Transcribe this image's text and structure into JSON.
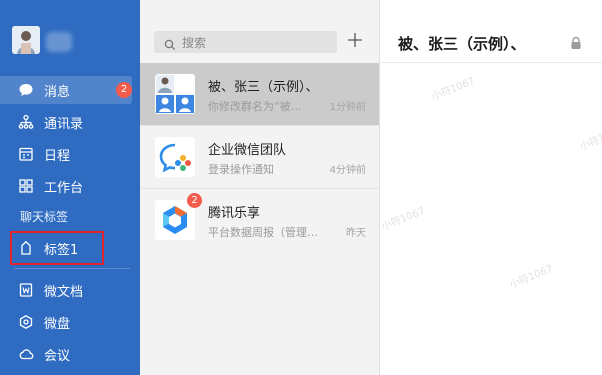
{
  "sidebar": {
    "badge_count": "2",
    "items": [
      {
        "label": "消息",
        "icon": "chat-bubble-icon"
      },
      {
        "label": "通讯录",
        "icon": "org-chart-icon"
      },
      {
        "label": "日程",
        "icon": "calendar-icon"
      },
      {
        "label": "工作台",
        "icon": "grid-icon"
      }
    ],
    "section_title": "聊天标签",
    "tag": {
      "label": "标签1",
      "icon": "tag-icon"
    },
    "apps": [
      {
        "label": "微文档",
        "icon": "document-w-icon"
      },
      {
        "label": "微盘",
        "icon": "cloud-drive-icon"
      },
      {
        "label": "会议",
        "icon": "meeting-cloud-icon"
      }
    ]
  },
  "middle": {
    "search_placeholder": "搜索",
    "conversations": [
      {
        "name": "被、张三（示例）、",
        "preview": "你修改群名为“被…",
        "time": "1分钟前"
      },
      {
        "name": "企业微信团队",
        "preview": "登录操作通知",
        "time": "4分钟前"
      },
      {
        "name": "腾讯乐享",
        "preview": "平台数据周报（管理…",
        "time": "昨天",
        "badge": "2"
      }
    ]
  },
  "chat": {
    "title": "被、张三（示例）、"
  },
  "watermark": "小符1067",
  "colors": {
    "sidebar": "#2f6cc1",
    "badge": "#f35c4d",
    "highlight": "#e0242b",
    "selected_row": "#cbcbcb"
  }
}
